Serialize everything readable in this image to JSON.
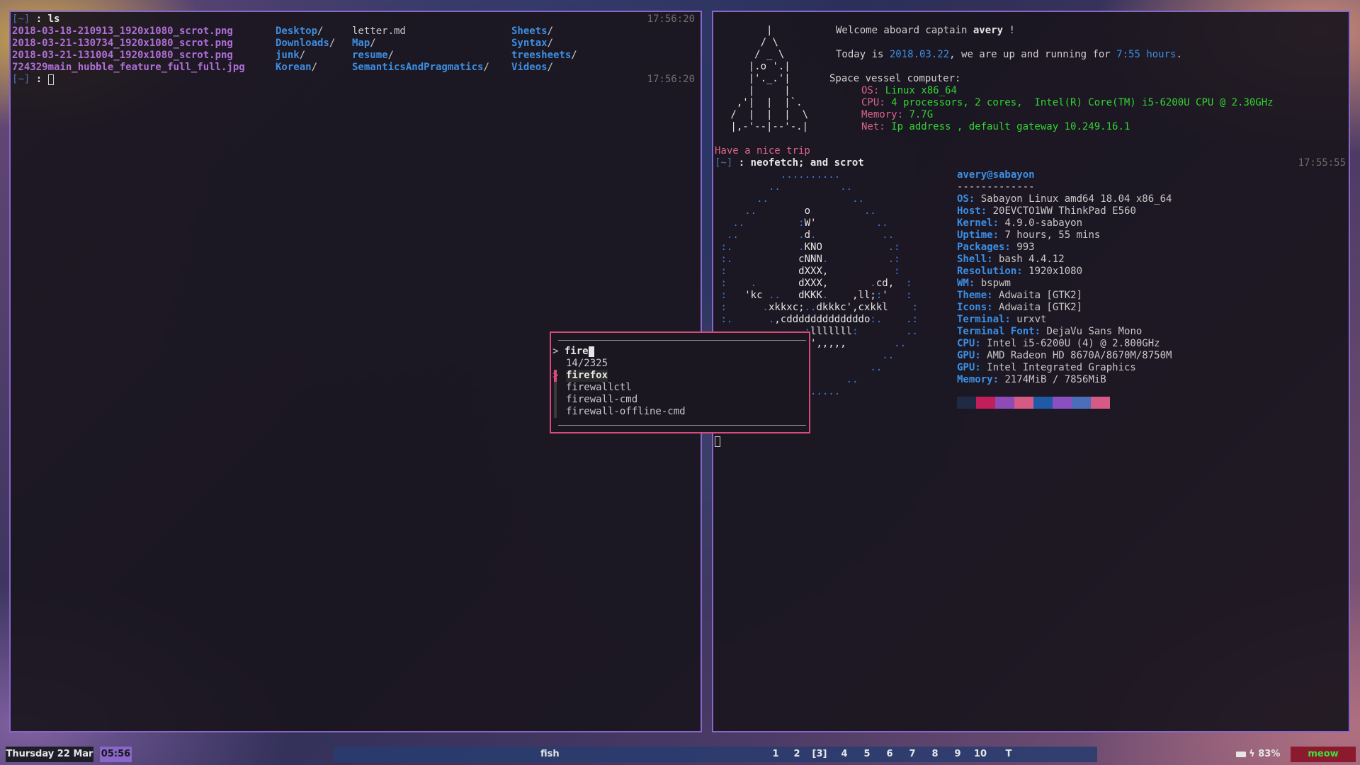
{
  "left_terminal": {
    "cmd_prompt": "[~]",
    "cmd": ": ls",
    "time1": "17:56:20",
    "files": [
      [
        "2018-03-18-210913_1920x1080_scrot.png",
        "Desktop",
        "/",
        "letter.md",
        "Sheets",
        "/"
      ],
      [
        "2018-03-21-130734_1920x1080_scrot.png",
        "Downloads",
        "/",
        "Map",
        "Syntax",
        "/"
      ],
      [
        "2018-03-21-131004_1920x1080_scrot.png",
        "junk",
        "/",
        "resume",
        "treesheets",
        "/"
      ],
      [
        "724329main_hubble_feature_full_full.jpg",
        "Korean",
        "/",
        "SemanticsAndPragmatics",
        "Videos",
        "/"
      ]
    ],
    "prompt2": "[~]",
    "prompt2_colon": ":",
    "time2": "17:56:20"
  },
  "right_terminal": {
    "rocket": [
      "       |",
      "      / \\",
      "     / _ \\",
      "    |.o '.|",
      "    |'._.'|",
      "    |     |",
      "  ,'|  |  |`.",
      " /  |  |  |  \\",
      " |,-'--|--'-.|"
    ],
    "welcome_prefix": "Welcome aboard captain ",
    "welcome_name": "avery",
    "welcome_suffix": " !",
    "today_prefix": "Today is ",
    "today_date": "2018.03.22",
    "today_mid": ", we are up and running for ",
    "today_hours": "7:55 hours",
    "today_end": ".",
    "vessel": "Space vessel computer:",
    "os": "OS: Linux x86_64",
    "cpu": "CPU: 4 processors, 2 cores,  Intel(R) Core(TM) i5-6200U CPU @ 2.30GHz",
    "memory": "Memory: 7.7G",
    "net": "Net: Ip address , default gateway 10.249.16.1",
    "nice_trip": "Have a nice trip",
    "cmd_prompt": "[~]",
    "cmd": " : neofetch; and scrot",
    "time": "17:55:55",
    "neofetch_art": [
      "           ..........",
      "         ..          ..",
      "       ..              ..",
      "     ..        o         ..",
      "   ..         :W'          ..",
      "  ..          .d.           ..",
      " :.           .KNO           .:",
      " :.           cNNN.          .:",
      " :            dXXX,           :",
      " :    .       dXXX,       .cd,  :",
      " :   'kc ..   dKKK.    ,ll;:'   :",
      " :      .xkkxc;..dkkkc',cxkkl    :",
      " :.      .,cdddddddddddddo:.    .:",
      "  ..           :lllllll:        ..",
      "   ..           ',,,,,        ..",
      "     ..                     ..",
      "       ..                 ..",
      "         ..           ..",
      "           .........."
    ],
    "user_host": "avery@sabayon",
    "dashes": "-------------",
    "info": [
      {
        "k": "OS",
        "v": "Sabayon Linux amd64 18.04 x86_64"
      },
      {
        "k": "Host",
        "v": "20EVCTO1WW ThinkPad E560"
      },
      {
        "k": "Kernel",
        "v": "4.9.0-sabayon"
      },
      {
        "k": "Uptime",
        "v": "7 hours, 55 mins"
      },
      {
        "k": "Packages",
        "v": "993"
      },
      {
        "k": "Shell",
        "v": "bash 4.4.12"
      },
      {
        "k": "Resolution",
        "v": "1920x1080"
      },
      {
        "k": "WM",
        "v": "bspwm"
      },
      {
        "k": "Theme",
        "v": "Adwaita [GTK2]"
      },
      {
        "k": "Icons",
        "v": "Adwaita [GTK2]"
      },
      {
        "k": "Terminal",
        "v": "urxvt"
      },
      {
        "k": "Terminal Font",
        "v": "DejaVu Sans Mono"
      },
      {
        "k": "CPU",
        "v": "Intel i5-6200U (4) @ 2.800GHz"
      },
      {
        "k": "GPU",
        "v": "AMD Radeon HD 8670A/8670M/8750M"
      },
      {
        "k": "GPU",
        "v": "Intel Integrated Graphics"
      },
      {
        "k": "Memory",
        "v": "2174MiB / 7856MiB"
      }
    ],
    "swatches": [
      "#1f2a44",
      "#c21f5a",
      "#8c4bb5",
      "#d65a86",
      "#1f5aa6",
      "#8a4fc0",
      "#4a6fb8",
      "#d65a86"
    ]
  },
  "launcher": {
    "prompt": ">",
    "query": "fire",
    "count": "14/2325",
    "selected_marker": ">",
    "items": [
      {
        "match": "fire",
        "rest": "fox"
      },
      {
        "match": "fire",
        "rest": "wallctl"
      },
      {
        "match": "fire",
        "rest": "wall-cmd"
      },
      {
        "match": "fire",
        "rest": "wall-offline-cmd"
      }
    ]
  },
  "bar": {
    "date": "Thursday 22 Mar",
    "clock": "05:56",
    "window_title": "fish",
    "workspaces": [
      "1",
      "2",
      "[3]",
      "4",
      "5",
      "6",
      "7",
      "8",
      "9",
      "10",
      "T"
    ],
    "battery": "83%",
    "meow": "meow",
    "colors": {
      "accent": "#8a66c9",
      "launcher_border": "#d64a7c",
      "meow_bg": "#8b1a2e",
      "meow_fg": "#3ee03e"
    }
  }
}
